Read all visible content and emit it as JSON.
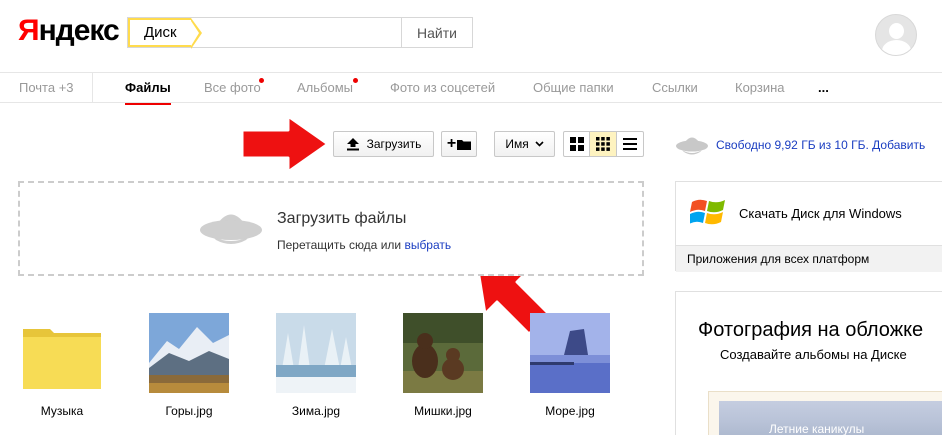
{
  "header": {
    "logo_ya": "Я",
    "logo_rest": "ндекс",
    "search_tag": "Диск",
    "search_value": "",
    "search_button": "Найти"
  },
  "nav": {
    "items": [
      {
        "label": "Почта +3"
      },
      {
        "label": "Файлы",
        "active": true
      },
      {
        "label": "Все фото",
        "dot": true
      },
      {
        "label": "Альбомы",
        "dot": true
      },
      {
        "label": "Фото из соцсетей"
      },
      {
        "label": "Общие папки"
      },
      {
        "label": "Ссылки"
      },
      {
        "label": "Корзина"
      },
      {
        "label": "..."
      }
    ]
  },
  "toolbar": {
    "upload_label": "Загрузить",
    "new_folder_label": "+",
    "sort_label": "Имя",
    "view_modes": [
      "large-tiles",
      "tiles",
      "list"
    ],
    "active_view": "tiles"
  },
  "dropzone": {
    "title": "Загрузить файлы",
    "subtitle": "Перетащить сюда или ",
    "link": "выбрать"
  },
  "files": [
    {
      "name": "Музыка",
      "kind": "folder"
    },
    {
      "name": "Горы.jpg",
      "kind": "image"
    },
    {
      "name": "Зима.jpg",
      "kind": "image"
    },
    {
      "name": "Мишки.jpg",
      "kind": "image"
    },
    {
      "name": "Море.jpg",
      "kind": "image"
    }
  ],
  "sidebar": {
    "space_text": "Свободно 9,92 ГБ из 10 ГБ.  Добавить",
    "promo_text": "Скачать Диск для Windows",
    "promo_footer": "Приложения для всех платформ",
    "album_title": "Фотография на обложке",
    "album_sub": "Создавайте альбомы на Диске",
    "album_pic_label": "Летние каникулы"
  },
  "colors": {
    "accent_red": "#e00000",
    "link_blue": "#1a3dc1",
    "tag_yellow": "#ffdb4d"
  }
}
